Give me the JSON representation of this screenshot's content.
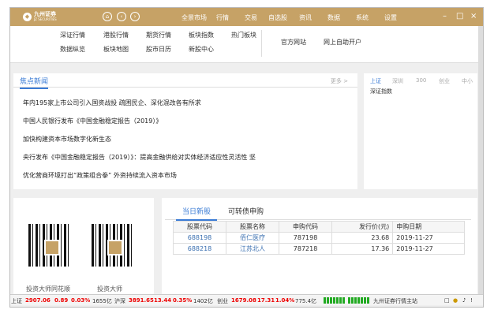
{
  "title": {
    "logo": "九州证券",
    "logo_sub": "JZ SECURITIES",
    "menu": [
      "全景市场",
      "行情",
      "交易",
      "自选股",
      "资讯",
      "数据",
      "系统",
      "设置"
    ]
  },
  "nav": {
    "links": [
      "深证行情",
      "港股行情",
      "期货行情",
      "板块指数",
      "热门板块",
      "数据纵览",
      "板块地图",
      "股市日历",
      "新股中心"
    ],
    "right": [
      "官方网站",
      "网上自助开户"
    ]
  },
  "news": {
    "title": "焦点新闻",
    "more": "更多 >",
    "items": [
      "年内195家上市公司引入国资战投 疏困民企、深化混改各有所求",
      "中国人民银行发布《中国金融稳定报告（2019）》",
      "加快构建资本市场数字化新生态",
      "央行发布《中国金融稳定报告（2019）》：提高金融供给对实体经济适应性灵活性 坚",
      "优化营商环境打出“政策组合拳” 外资持续流入资本市场"
    ]
  },
  "index": {
    "tabs": [
      "上证",
      "深圳",
      "300",
      "创业",
      "中小"
    ],
    "label": "深证指数"
  },
  "qr": {
    "labels": [
      "投资大师同花顺",
      "投资大师"
    ]
  },
  "ipo": {
    "tabs": [
      "当日新股",
      "可转债申购"
    ],
    "headers": [
      "股票代码",
      "股票名称",
      "申购代码",
      "发行价(元)",
      "申购日期"
    ],
    "rows": [
      [
        "688198",
        "佰仁医疗",
        "787198",
        "23.68",
        "2019-11-27"
      ],
      [
        "688218",
        "江苏北人",
        "787218",
        "17.36",
        "2019-11-27"
      ]
    ]
  },
  "status": {
    "sh": {
      "name": "上证",
      "price": "2907.06",
      "chg": "0.89",
      "pct": "0.03%",
      "vol": "1655亿"
    },
    "hs": {
      "name": "沪深",
      "price": "3891.65",
      "chg": "13.44",
      "pct": "0.35%",
      "vol": "1402亿"
    },
    "cy": {
      "name": "创业",
      "price": "1679.08",
      "chg": "17.31",
      "pct": "1.04%",
      "vol": "775.4亿"
    },
    "server": "九州证券行情主站"
  }
}
